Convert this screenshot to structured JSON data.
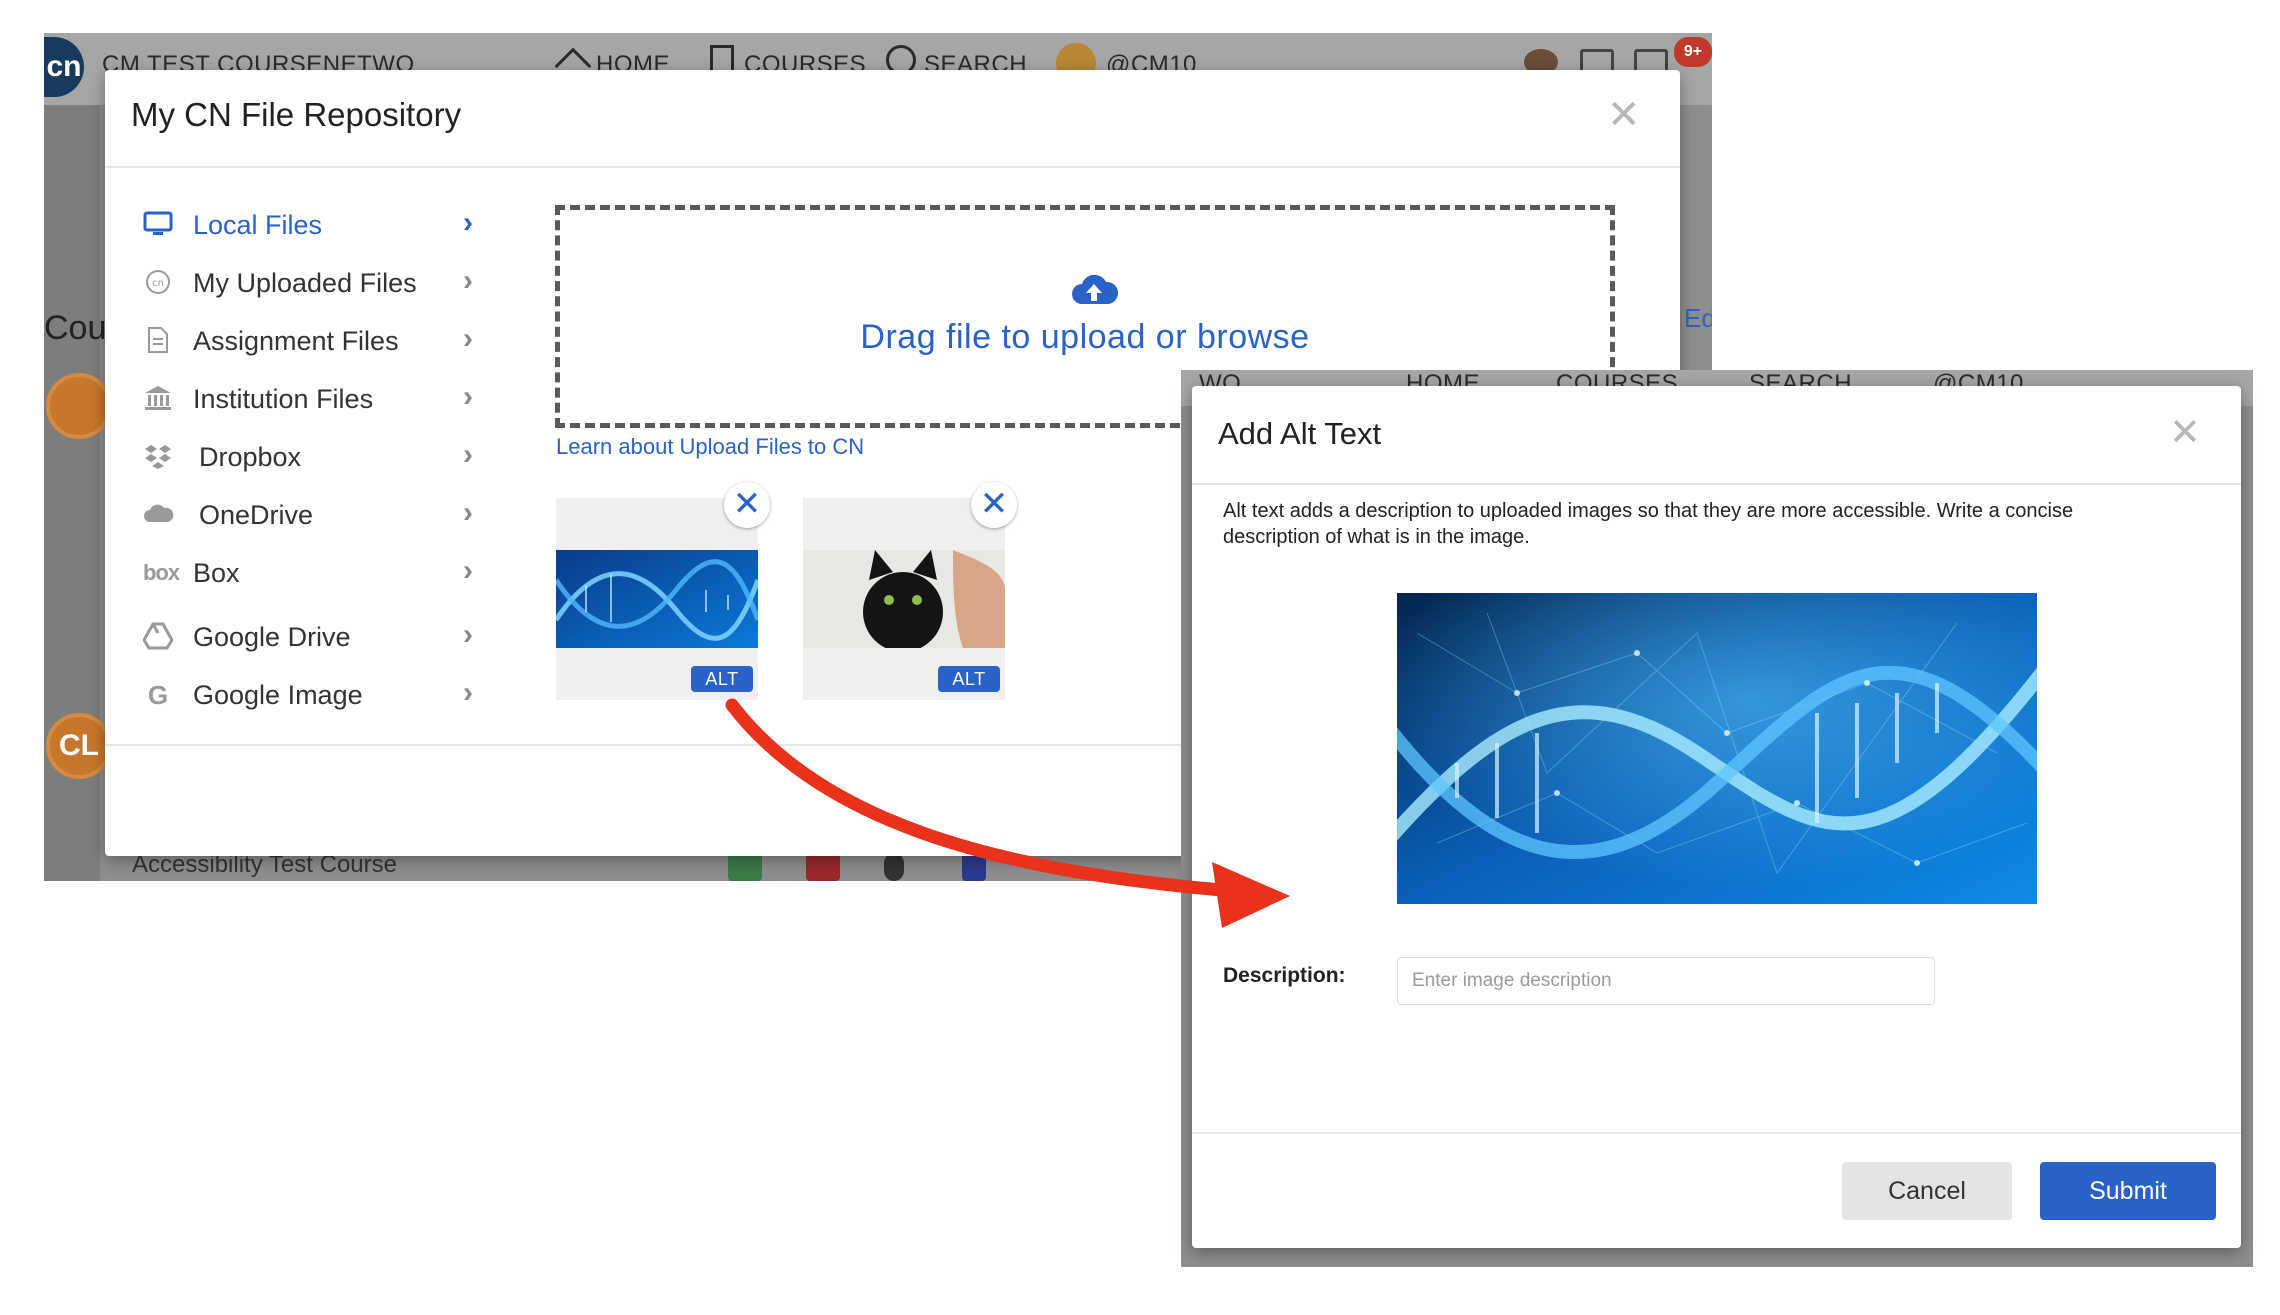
{
  "background_app": {
    "course_name": "CM TEST COURSENETWO",
    "logo_text": "cn",
    "nav": {
      "home": "HOME",
      "courses": "COURSES",
      "search": "SEARCH",
      "user": "@CM10"
    },
    "notification_count": "9+",
    "section_heading_partial": "Cou",
    "edit_partial": "Edi",
    "course_item": "Accessibility Test Course",
    "cl_badge": "CL"
  },
  "background_app_2": {
    "nav": {
      "partial": "WO",
      "home": "HOME",
      "courses": "COURSES",
      "search": "SEARCH",
      "user": "@CM10"
    }
  },
  "file_repo_modal": {
    "title": "My CN File Repository",
    "close_icon": "close-icon",
    "sources": [
      {
        "label": "Local Files",
        "icon": "monitor-icon",
        "active": true
      },
      {
        "label": "My Uploaded Files",
        "icon": "cn-circle-icon",
        "active": false
      },
      {
        "label": "Assignment Files",
        "icon": "document-icon",
        "active": false
      },
      {
        "label": "Institution Files",
        "icon": "institution-icon",
        "active": false
      },
      {
        "label": "Dropbox",
        "icon": "dropbox-icon",
        "active": false
      },
      {
        "label": "OneDrive",
        "icon": "cloud-icon",
        "active": false
      },
      {
        "label": "Box",
        "icon": "box-icon",
        "active": false
      },
      {
        "label": "Google Drive",
        "icon": "google-drive-icon",
        "active": false
      },
      {
        "label": "Google Image",
        "icon": "google-icon",
        "active": false
      }
    ],
    "dropzone_text": "Drag file to upload or browse",
    "learn_link": "Learn about Upload Files to CN",
    "uploaded_images": [
      {
        "subject": "DNA double helix",
        "alt_label": "ALT",
        "remove_icon": "remove-icon"
      },
      {
        "subject": "Black kitten",
        "alt_label": "ALT",
        "remove_icon": "remove-icon"
      }
    ]
  },
  "alt_text_modal": {
    "title": "Add Alt Text",
    "description": "Alt text adds a description to uploaded images so that they are more accessible. Write a concise description of what is in the image.",
    "description_label": "Description:",
    "description_placeholder": "Enter image description",
    "description_value": "",
    "cancel_label": "Cancel",
    "submit_label": "Submit"
  },
  "colors": {
    "accent_blue": "#2a63c7",
    "annotation_arrow": "#e8321c",
    "overlay_gray": "#8e8e8e"
  }
}
